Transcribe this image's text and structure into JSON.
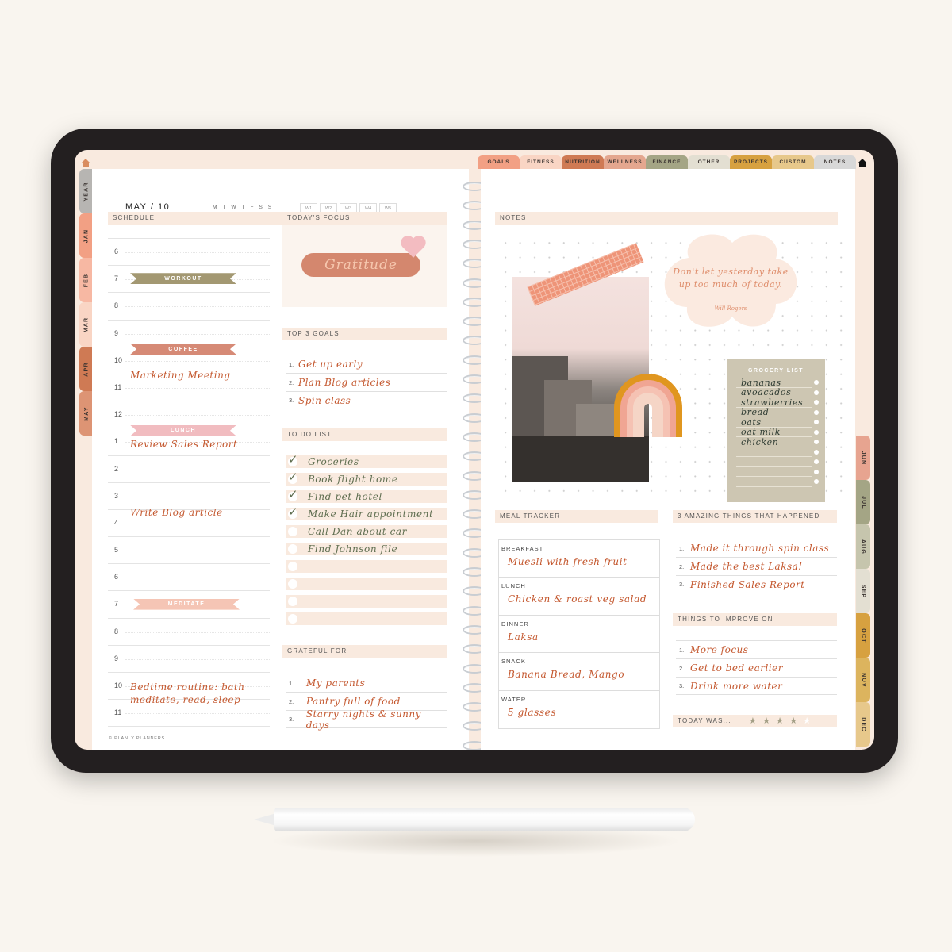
{
  "colors": {
    "accent_handwriting": "#c4582f",
    "todo_text": "#5f6e50",
    "section_header_bg": "#f9eadf",
    "tablet_frame": "#231f20"
  },
  "icons": {
    "home": "home-icon",
    "check": "✓",
    "star": "★"
  },
  "left_tabs": [
    {
      "label": "YEAR",
      "color": "#b7b5b2"
    },
    {
      "label": "JAN",
      "color": "#f2a084"
    },
    {
      "label": "FEB",
      "color": "#f7b8a3"
    },
    {
      "label": "MAR",
      "color": "#f9d5c4"
    },
    {
      "label": "APR",
      "color": "#cf7a54"
    },
    {
      "label": "MAY",
      "color": "#dd9474"
    }
  ],
  "right_tabs": [
    {
      "label": "JUN",
      "color": "#e7a490"
    },
    {
      "label": "JUL",
      "color": "#a4a585"
    },
    {
      "label": "AUG",
      "color": "#c6c5ad"
    },
    {
      "label": "SEP",
      "color": "#e3dfd2"
    },
    {
      "label": "OCT",
      "color": "#d7a140"
    },
    {
      "label": "NOV",
      "color": "#dcb45e"
    },
    {
      "label": "DEC",
      "color": "#e7c88b"
    }
  ],
  "top_tabs": [
    {
      "label": "GOALS",
      "color": "#f2a084"
    },
    {
      "label": "FITNESS",
      "color": "#f9d5c4"
    },
    {
      "label": "NUTRITION",
      "color": "#cf7a54"
    },
    {
      "label": "WELLNESS",
      "color": "#e4a78f"
    },
    {
      "label": "FINANCE",
      "color": "#a4a585"
    },
    {
      "label": "OTHER",
      "color": "#e3dfd2"
    },
    {
      "label": "PROJECTS",
      "color": "#d7a140"
    },
    {
      "label": "CUSTOM",
      "color": "#e7c88b"
    },
    {
      "label": "NOTES",
      "color": "#d8d8d8"
    }
  ],
  "header": {
    "date": "MAY / 10",
    "weekdays": [
      "M",
      "T",
      "W",
      "T",
      "F",
      "S",
      "S"
    ],
    "weeks": [
      "W1",
      "W2",
      "W3",
      "W4",
      "W5"
    ]
  },
  "schedule": {
    "title": "SCHEDULE",
    "hours": [
      "6",
      "7",
      "8",
      "9",
      "10",
      "11",
      "12",
      "1",
      "2",
      "3",
      "4",
      "5",
      "6",
      "7",
      "8",
      "9",
      "10",
      "11"
    ],
    "banners": [
      {
        "label": "WORKOUT",
        "color": "#a39872"
      },
      {
        "label": "COFFEE",
        "color": "#d68a76"
      },
      {
        "label": "LUNCH",
        "color": "#f1bcc0"
      },
      {
        "label": "MEDITATE",
        "color": "#f5c5b5"
      }
    ],
    "notes": [
      "Marketing Meeting",
      "Review Sales Report",
      "Write Blog article",
      "Bedtime routine: bath",
      "meditate, read, sleep"
    ]
  },
  "focus": {
    "title": "TODAY'S FOCUS",
    "word": "Gratitude"
  },
  "goals": {
    "title": "TOP 3 GOALS",
    "items": [
      {
        "num": "1.",
        "text": "Get up early"
      },
      {
        "num": "2.",
        "text": "Plan Blog articles"
      },
      {
        "num": "3.",
        "text": "Spin class"
      }
    ]
  },
  "todo": {
    "title": "TO DO LIST",
    "items": [
      {
        "text": "Groceries",
        "done": true
      },
      {
        "text": "Book flight home",
        "done": true
      },
      {
        "text": "Find pet hotel",
        "done": true
      },
      {
        "text": "Make Hair appointment",
        "done": true
      },
      {
        "text": "Call Dan about car",
        "done": false
      },
      {
        "text": "Find Johnson file",
        "done": false
      },
      {
        "text": "",
        "done": false
      },
      {
        "text": "",
        "done": false
      },
      {
        "text": "",
        "done": false
      },
      {
        "text": "",
        "done": false
      }
    ]
  },
  "grateful": {
    "title": "GRATEFUL FOR",
    "items": [
      {
        "num": "1.",
        "text": "My parents"
      },
      {
        "num": "2.",
        "text": "Pantry full of food"
      },
      {
        "num": "3.",
        "text": "Starry nights & sunny days"
      }
    ]
  },
  "copyright": "© PLANLY PLANNERS",
  "notes": {
    "title": "NOTES",
    "quote": "Don't let yesterday take up too much of today.",
    "quote_author": "Will Rogers",
    "grocery": {
      "title": "GROCERY LIST",
      "items": [
        "bananas",
        "avoacados",
        "strawberries",
        "bread",
        "oats",
        "oat milk",
        "chicken",
        "",
        "",
        "",
        ""
      ]
    }
  },
  "meal_tracker": {
    "title": "MEAL TRACKER",
    "rows": [
      {
        "label": "BREAKFAST",
        "value": "Muesli with fresh fruit"
      },
      {
        "label": "LUNCH",
        "value": "Chicken & roast veg salad"
      },
      {
        "label": "DINNER",
        "value": "Laksa"
      },
      {
        "label": "SNACK",
        "value": "Banana Bread, Mango"
      },
      {
        "label": "WATER",
        "value": "5 glasses"
      }
    ]
  },
  "amazing": {
    "title": "3 AMAZING THINGS THAT HAPPENED",
    "items": [
      {
        "num": "1.",
        "text": "Made it through spin class"
      },
      {
        "num": "2.",
        "text": "Made the best Laksa!"
      },
      {
        "num": "3.",
        "text": "Finished Sales Report"
      }
    ]
  },
  "improve": {
    "title": "THINGS TO IMPROVE ON",
    "items": [
      {
        "num": "1.",
        "text": "More focus"
      },
      {
        "num": "2.",
        "text": "Get to bed earlier"
      },
      {
        "num": "3.",
        "text": "Drink more water"
      }
    ]
  },
  "rating": {
    "label": "TODAY WAS...",
    "value": 4,
    "max": 5
  }
}
